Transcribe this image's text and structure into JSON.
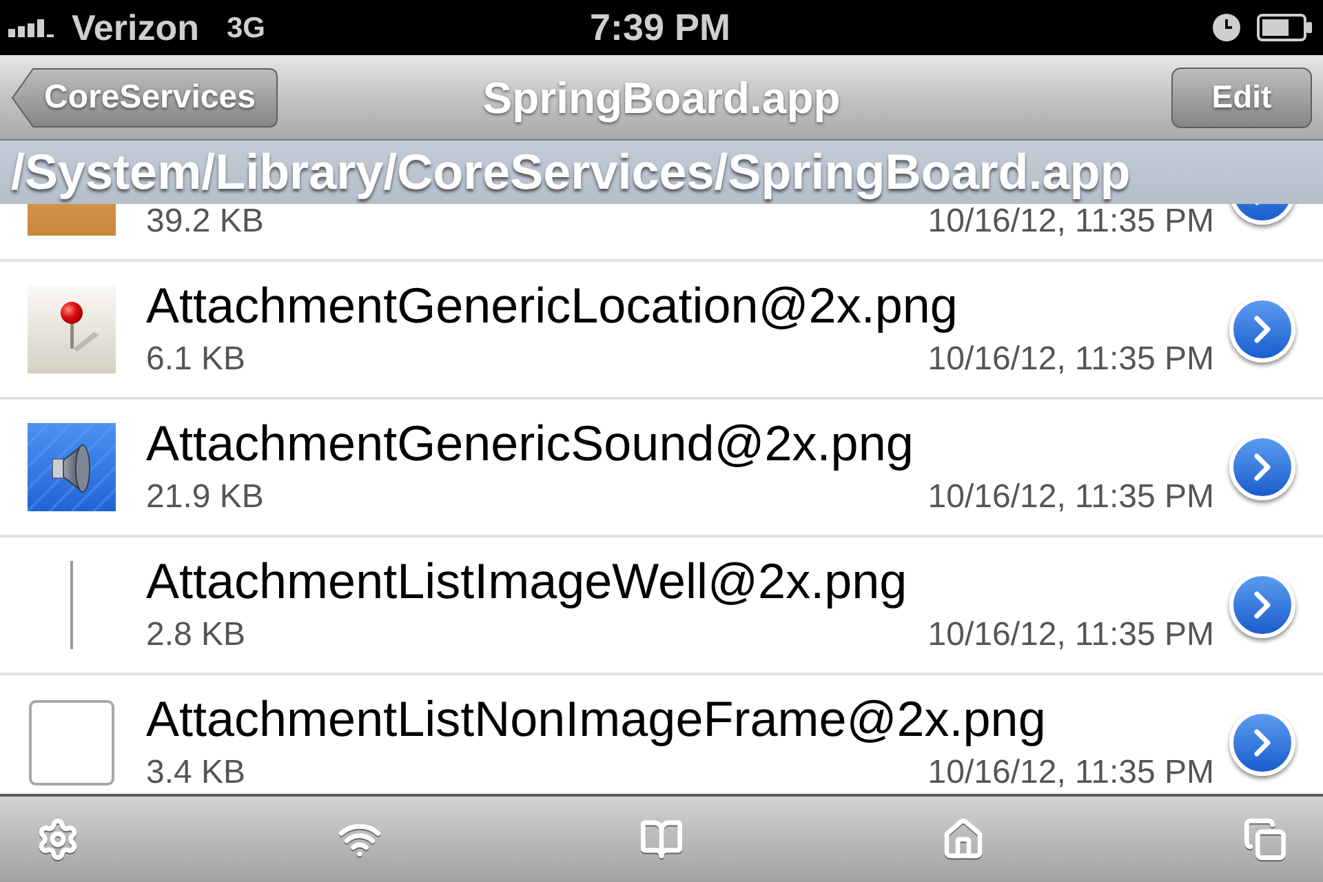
{
  "status_bar": {
    "carrier": "Verizon",
    "network": "3G",
    "time": "7:39 PM"
  },
  "nav_bar": {
    "back_button": "CoreServices",
    "title": "SpringBoard.app",
    "edit_button": "Edit"
  },
  "path": "/System/Library/CoreServices/SpringBoard.app",
  "files": [
    {
      "size": "39.2 KB",
      "date": "10/16/12, 11:35 PM"
    },
    {
      "name": "AttachmentGenericLocation@2x.png",
      "size": "6.1 KB",
      "date": "10/16/12, 11:35 PM"
    },
    {
      "name": "AttachmentGenericSound@2x.png",
      "size": "21.9 KB",
      "date": "10/16/12, 11:35 PM"
    },
    {
      "name": "AttachmentListImageWell@2x.png",
      "size": "2.8 KB",
      "date": "10/16/12, 11:35 PM"
    },
    {
      "name": "AttachmentListNonImageFrame@2x.png",
      "size": "3.4 KB",
      "date": "10/16/12, 11:35 PM"
    }
  ]
}
